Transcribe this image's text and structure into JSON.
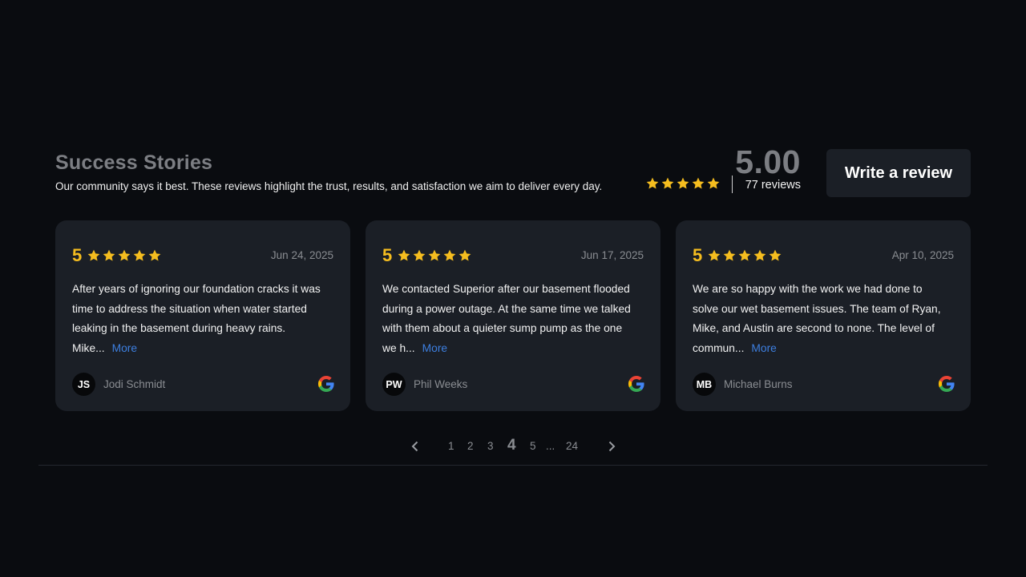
{
  "header": {
    "title": "Success Stories",
    "subtitle": "Our community says it best. These reviews highlight the trust, results, and satisfaction we aim to deliver every day."
  },
  "summary": {
    "average": "5.00",
    "stars": 5,
    "count_label": "77 reviews"
  },
  "write_review_label": "Write a review",
  "reviews": [
    {
      "rating": "5",
      "date": "Jun 24, 2025",
      "text": "After years of ignoring our foundation cracks it was time to address the situation when water started leaking in the basement during heavy rains. Mike...",
      "more_label": "More",
      "initials": "JS",
      "author": "Jodi Schmidt",
      "source_icon": "google-icon"
    },
    {
      "rating": "5",
      "date": "Jun 17, 2025",
      "text": "We contacted Superior after our basement flooded during a power outage. At the same time we talked with them about a quieter sump pump as the one we h...",
      "more_label": "More",
      "initials": "PW",
      "author": "Phil Weeks",
      "source_icon": "google-icon"
    },
    {
      "rating": "5",
      "date": "Apr 10, 2025",
      "text": "We are so happy with the work we had done to solve our wet basement issues. The team of Ryan, Mike, and Austin are second to none. The level of commun...",
      "more_label": "More",
      "initials": "MB",
      "author": "Michael Burns",
      "source_icon": "google-icon"
    }
  ],
  "pagination": {
    "pages": [
      "1",
      "2",
      "3",
      "4",
      "5"
    ],
    "current": "4",
    "ellipsis": "...",
    "last": "24"
  },
  "colors": {
    "background": "#0a0c10",
    "card": "#1b1f26",
    "star": "#f5bd1f",
    "link": "#3d7fe0",
    "muted": "#8a8d92"
  }
}
